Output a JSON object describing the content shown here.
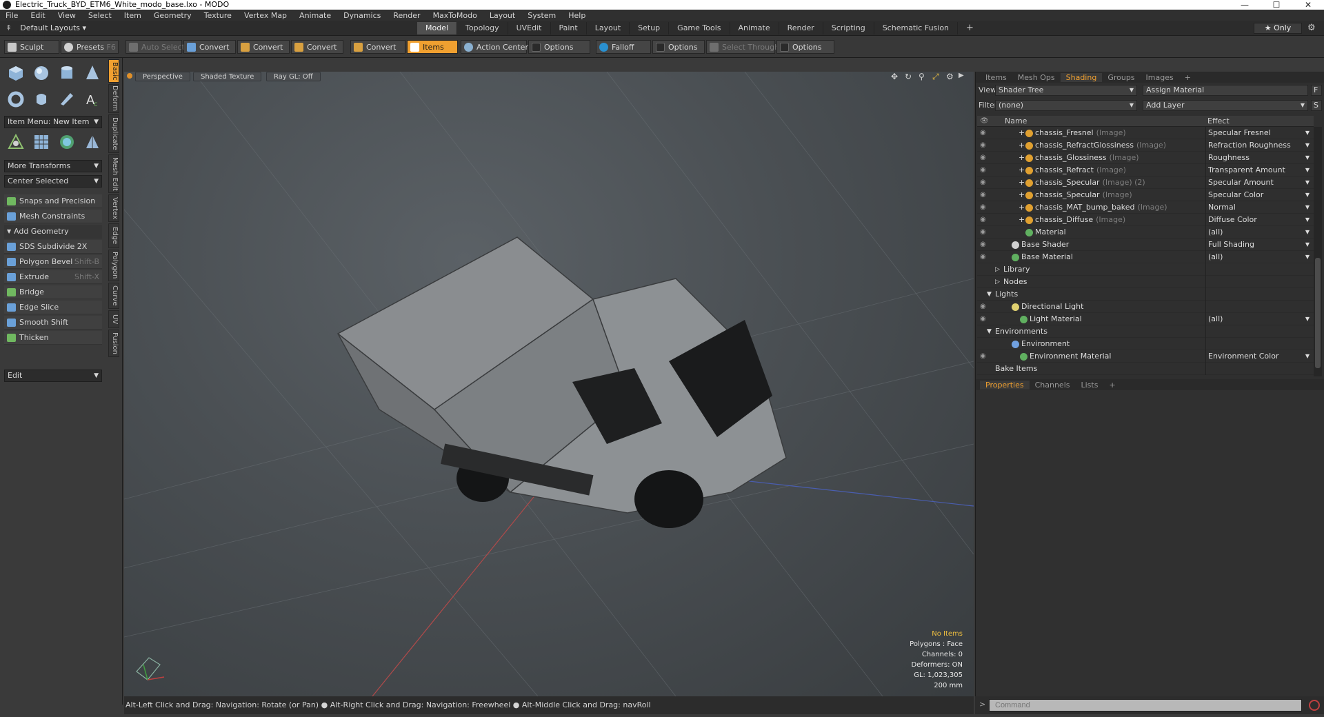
{
  "window": {
    "title": "Electric_Truck_BYD_ETM6_White_modo_base.lxo - MODO",
    "minimize": "—",
    "maximize": "☐",
    "close": "✕"
  },
  "menu": [
    "File",
    "Edit",
    "View",
    "Select",
    "Item",
    "Geometry",
    "Texture",
    "Vertex Map",
    "Animate",
    "Dynamics",
    "Render",
    "MaxToModo",
    "Layout",
    "System",
    "Help"
  ],
  "layout": {
    "default_layouts": "Default Layouts ▾",
    "tabs": [
      "Model",
      "Topology",
      "UVEdit",
      "Paint",
      "Layout",
      "Setup",
      "Game Tools",
      "Animate",
      "Render",
      "Scripting",
      "Schematic Fusion"
    ],
    "active_tab": "Model",
    "add": "+",
    "only": "★ Only",
    "gear": "⚙"
  },
  "toolbar": {
    "sculpt": "Sculpt",
    "presets": "Presets",
    "presets_key": "F6",
    "auto_select": "Auto Select",
    "convert": "Convert",
    "items": "Items",
    "action_center": "Action Center",
    "options": "Options",
    "falloff": "Falloff",
    "select_through": "Select Through"
  },
  "left_panel": {
    "item_menu": "Item Menu: New Item",
    "more_transforms": "More Transforms",
    "center_selected": "Center Selected",
    "snaps": "Snaps and Precision",
    "mesh_constraints": "Mesh Constraints",
    "add_geometry": "Add Geometry",
    "tools": [
      {
        "label": "SDS Subdivide 2X",
        "key": "",
        "color": "#6aa0d8"
      },
      {
        "label": "Polygon Bevel",
        "key": "Shift-B",
        "color": "#6aa0d8"
      },
      {
        "label": "Extrude",
        "key": "Shift-X",
        "color": "#6aa0d8"
      },
      {
        "label": "Bridge",
        "key": "",
        "color": "#70b860"
      },
      {
        "label": "Edge Slice",
        "key": "",
        "color": "#6aa0d8"
      },
      {
        "label": "Smooth Shift",
        "key": "",
        "color": "#6aa0d8"
      },
      {
        "label": "Thicken",
        "key": "",
        "color": "#70b860"
      }
    ],
    "edit": "Edit",
    "side_tabs": [
      "Basic",
      "Deform",
      "Duplicate",
      "Mesh Edit",
      "Vertex",
      "Edge",
      "Polygon",
      "Curve",
      "UV",
      "Fusion"
    ]
  },
  "viewport": {
    "perspective": "Perspective",
    "shaded": "Shaded Texture",
    "raygl": "Ray GL: Off",
    "info": {
      "no_items": "No Items",
      "polygons": "Polygons : Face",
      "channels": "Channels: 0",
      "deformers": "Deformers: ON",
      "gl": "GL: 1,023,305",
      "scale": "200 mm"
    }
  },
  "status": "Alt-Left Click and Drag: Navigation: Rotate (or Pan) ● Alt-Right Click and Drag: Navigation: Freewheel ● Alt-Middle Click and Drag: navRoll",
  "right_panel": {
    "tabs": [
      "Items",
      "Mesh Ops",
      "Shading",
      "Groups",
      "Images"
    ],
    "active_tab": "Shading",
    "add": "+",
    "view_label": "View",
    "view_value": "Shader Tree",
    "assign_material": "Assign Material",
    "assign_key": "F",
    "filter_label": "Filter",
    "filter_value": "(none)",
    "add_layer": "Add Layer",
    "add_layer_key": "S",
    "col_name": "Name",
    "col_effect": "Effect",
    "rows": [
      {
        "name": "chassis_Fresnel",
        "type": "(Image)",
        "effect": "Specular Fresnel",
        "eye": true,
        "indent": 70,
        "kind": "img"
      },
      {
        "name": "chassis_RefractGlossiness",
        "type": "(Image)",
        "effect": "Refraction Roughness",
        "eye": true,
        "indent": 70,
        "kind": "img"
      },
      {
        "name": "chassis_Glossiness",
        "type": "(Image)",
        "effect": "Roughness",
        "eye": true,
        "indent": 70,
        "kind": "img"
      },
      {
        "name": "chassis_Refract",
        "type": "(Image)",
        "effect": "Transparent Amount",
        "eye": true,
        "indent": 70,
        "kind": "img"
      },
      {
        "name": "chassis_Specular",
        "type": "(Image) (2)",
        "effect": "Specular Amount",
        "eye": true,
        "indent": 70,
        "kind": "img"
      },
      {
        "name": "chassis_Specular",
        "type": "(Image)",
        "effect": "Specular Color",
        "eye": true,
        "indent": 70,
        "kind": "img"
      },
      {
        "name": "chassis_MAT_bump_baked",
        "type": "(Image)",
        "effect": "Normal",
        "eye": true,
        "indent": 70,
        "kind": "img"
      },
      {
        "name": "chassis_Diffuse",
        "type": "(Image)",
        "effect": "Diffuse Color",
        "eye": true,
        "indent": 70,
        "kind": "img"
      },
      {
        "name": "Material",
        "type": "",
        "effect": "(all)",
        "eye": true,
        "indent": 70,
        "kind": "mat"
      },
      {
        "name": "Base Shader",
        "type": "",
        "effect": "Full Shading",
        "eye": true,
        "indent": 50,
        "kind": "shader"
      },
      {
        "name": "Base Material",
        "type": "",
        "effect": "(all)",
        "eye": true,
        "indent": 50,
        "kind": "mat"
      },
      {
        "name": "Library",
        "type": "",
        "effect": "",
        "eye": false,
        "indent": 38,
        "kind": "folder"
      },
      {
        "name": "Nodes",
        "type": "",
        "effect": "",
        "eye": false,
        "indent": 38,
        "kind": "folder"
      },
      {
        "name": "Lights",
        "type": "",
        "effect": "",
        "eye": false,
        "indent": 26,
        "kind": "group"
      },
      {
        "name": "Directional Light",
        "type": "",
        "effect": "",
        "eye": true,
        "indent": 50,
        "kind": "light"
      },
      {
        "name": "Light Material",
        "type": "",
        "effect": "(all)",
        "eye": true,
        "indent": 62,
        "kind": "mat"
      },
      {
        "name": "Environments",
        "type": "",
        "effect": "",
        "eye": false,
        "indent": 26,
        "kind": "group"
      },
      {
        "name": "Environment",
        "type": "",
        "effect": "",
        "eye": false,
        "indent": 50,
        "kind": "env"
      },
      {
        "name": "Environment Material",
        "type": "",
        "effect": "Environment Color",
        "eye": true,
        "indent": 62,
        "kind": "mat"
      },
      {
        "name": "Bake Items",
        "type": "",
        "effect": "",
        "eye": false,
        "indent": 26,
        "kind": "none"
      }
    ],
    "lower_tabs": [
      "Properties",
      "Channels",
      "Lists"
    ],
    "lower_active": "Properties",
    "command_placeholder": "Command"
  }
}
